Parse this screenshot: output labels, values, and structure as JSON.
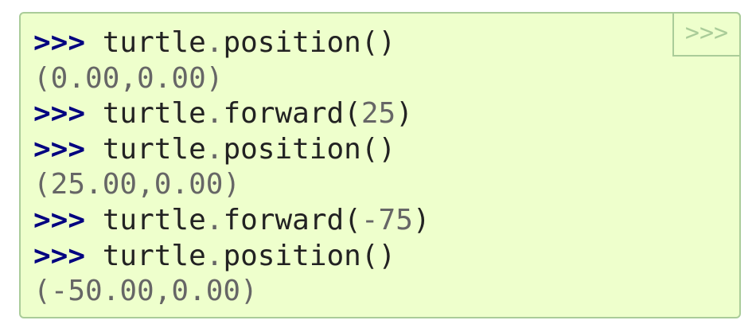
{
  "copy_button": {
    "label": ">>>"
  },
  "lines": [
    {
      "kind": "input",
      "prompt": ">>>",
      "object": "turtle",
      "dot": ".",
      "method": "position",
      "open": "(",
      "arg": "",
      "close": ")"
    },
    {
      "kind": "output",
      "text": "(0.00,0.00)"
    },
    {
      "kind": "input",
      "prompt": ">>>",
      "object": "turtle",
      "dot": ".",
      "method": "forward",
      "open": "(",
      "arg": "25",
      "close": ")"
    },
    {
      "kind": "input",
      "prompt": ">>>",
      "object": "turtle",
      "dot": ".",
      "method": "position",
      "open": "(",
      "arg": "",
      "close": ")"
    },
    {
      "kind": "output",
      "text": "(25.00,0.00)"
    },
    {
      "kind": "input",
      "prompt": ">>>",
      "object": "turtle",
      "dot": ".",
      "method": "forward",
      "open": "(",
      "arg": "-75",
      "close": ")"
    },
    {
      "kind": "input",
      "prompt": ">>>",
      "object": "turtle",
      "dot": ".",
      "method": "position",
      "open": "(",
      "arg": "",
      "close": ")"
    },
    {
      "kind": "output",
      "text": "(-50.00,0.00)"
    }
  ],
  "colors": {
    "background": "#eeffcc",
    "border": "#aacc99",
    "prompt": "#000080",
    "text": "#222222",
    "output": "#666666"
  }
}
